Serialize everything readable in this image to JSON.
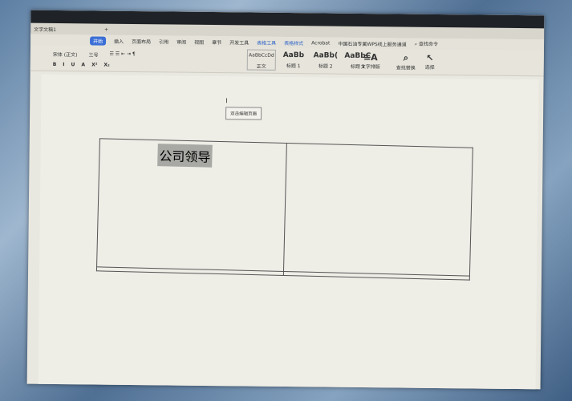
{
  "window": {
    "title": "文字文稿1"
  },
  "tabs": [
    "开始",
    "插入",
    "页面布局",
    "引用",
    "审阅",
    "视图",
    "章节",
    "开发工具",
    "表格工具",
    "表格样式",
    "Acrobat",
    "中国石油专属WPS线上服务通道",
    "查找命令"
  ],
  "ribbon": {
    "font_name": "宋体 (正文)",
    "font_size": "三号",
    "format_buttons": [
      "B",
      "I",
      "U",
      "A",
      "X²",
      "X₂"
    ],
    "styles": [
      {
        "preview": "AaBbCcDd",
        "label": "正文"
      },
      {
        "preview": "AaBb",
        "label": "标题 1"
      },
      {
        "preview": "AaBb(",
        "label": "标题 2"
      },
      {
        "preview": "AaBbC",
        "label": "标题 3"
      }
    ],
    "text_layout": "文字排版",
    "find_replace": "查找替换",
    "select": "选择"
  },
  "document": {
    "header_hint": "双击编辑页眉",
    "cell_text": "公司领导"
  }
}
